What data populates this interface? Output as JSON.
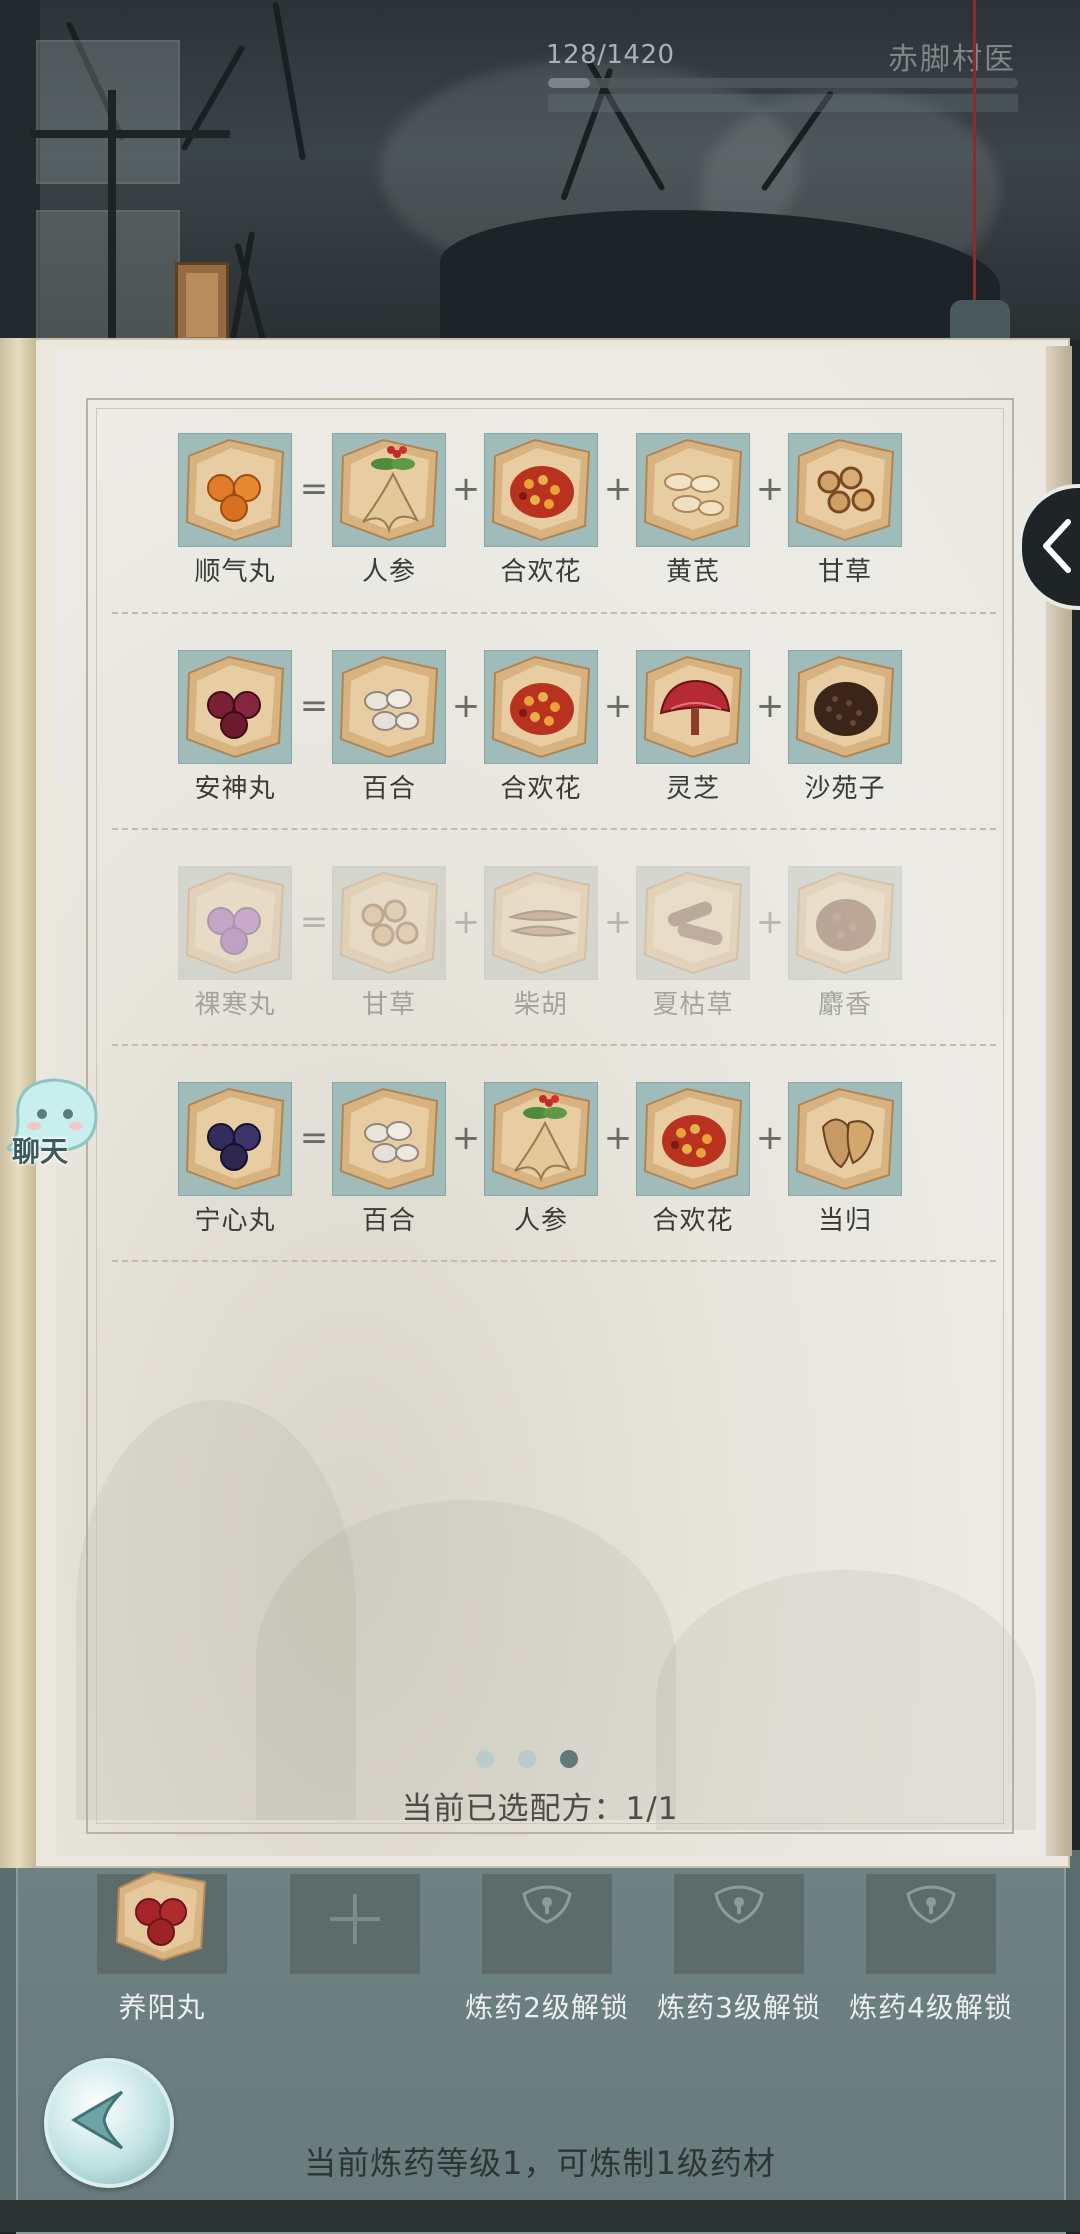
{
  "header": {
    "progress_text": "128/1420",
    "progress_fraction": 0.09,
    "npc_name": "赤脚村医"
  },
  "recipe_book": {
    "rows": [
      {
        "locked": false,
        "result": "顺气丸",
        "operators": [
          "=",
          "+",
          "+",
          "+"
        ],
        "ingredients": [
          "人参",
          "合欢花",
          "黄芪",
          "甘草"
        ]
      },
      {
        "locked": false,
        "result": "安神丸",
        "operators": [
          "=",
          "+",
          "+",
          "+"
        ],
        "ingredients": [
          "百合",
          "合欢花",
          "灵芝",
          "沙苑子"
        ]
      },
      {
        "locked": true,
        "result": "祼寒丸",
        "operators": [
          "=",
          "+",
          "+",
          "+"
        ],
        "ingredients": [
          "甘草",
          "柴胡",
          "夏枯草",
          "麝香"
        ]
      },
      {
        "locked": false,
        "result": "宁心丸",
        "operators": [
          "=",
          "+",
          "+",
          "+"
        ],
        "ingredients": [
          "百合",
          "人参",
          "合欢花",
          "当归"
        ]
      }
    ],
    "page_count": 3,
    "current_page": 3,
    "selected_text": "当前已选配方：1/1"
  },
  "chat": {
    "label": "聊天"
  },
  "tray": {
    "slots": [
      {
        "label": "养阳丸",
        "kind": "filled"
      },
      {
        "label": "",
        "kind": "empty-add"
      },
      {
        "label": "炼药2级解锁",
        "kind": "locked"
      },
      {
        "label": "炼药3级解锁",
        "kind": "locked"
      },
      {
        "label": "炼药4级解锁",
        "kind": "locked"
      }
    ],
    "status": "当前炼药等级1，可炼制1级药材"
  },
  "colors": {
    "tile_bg": "#9fbcbb",
    "page_bg": "#ecebe6",
    "tray_bg": "#6f8283",
    "dot_active": "#5e7a7b"
  }
}
